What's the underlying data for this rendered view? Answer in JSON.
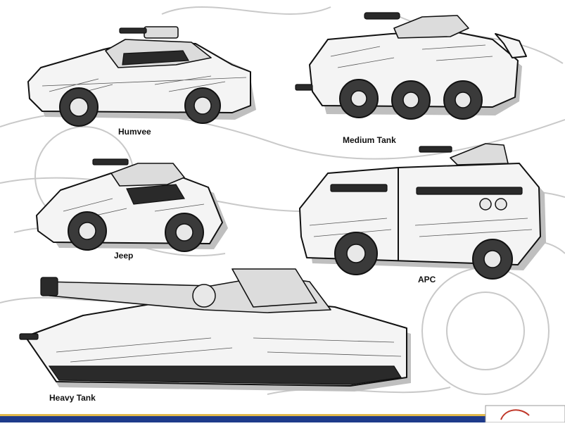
{
  "vehicles": {
    "humvee": {
      "label": "Humvee"
    },
    "medium_tank": {
      "label": "Medium Tank"
    },
    "jeep": {
      "label": "Jeep"
    },
    "apc": {
      "label": "APC"
    },
    "heavy_tank": {
      "label": "Heavy Tank"
    }
  },
  "colors": {
    "footer_bar": "#1e3a8a",
    "footer_accent": "#e0b84a",
    "stamp_red": "#c0392b"
  }
}
